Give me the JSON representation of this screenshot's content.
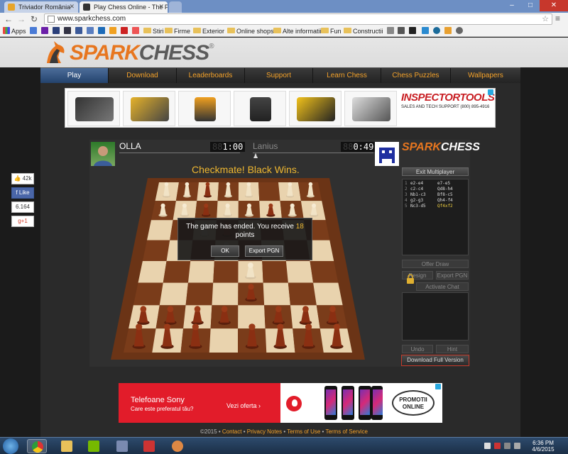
{
  "browser": {
    "tabs": [
      {
        "title": "Triviador România",
        "active": false
      },
      {
        "title": "Play Chess Online - The P",
        "active": true
      }
    ],
    "url": "www.sparkchess.com",
    "bookmarks": [
      "Apps",
      "Stiri",
      "Firme",
      "Exterior",
      "Online shops",
      "Alte informatii",
      "Fun",
      "Constructii"
    ]
  },
  "site": {
    "logo_spark": "SPARK",
    "logo_chess": "CHESS",
    "logo_reg": "®",
    "nav": [
      "Play",
      "Download",
      "Leaderboards",
      "Support",
      "Learn Chess",
      "Chess Puzzles",
      "Wallpapers"
    ],
    "active_nav": "Play"
  },
  "ad_top": {
    "brand": "INSPECTORTOOLS",
    "tagline": "SALES AND TECH SUPPORT (800) 895-4916"
  },
  "social": {
    "like_count": "42k",
    "like_label": "Like",
    "share_count": "6.164",
    "gplus_label": "+1"
  },
  "game": {
    "player_white": {
      "name": "OLLA",
      "clock": "1:00",
      "clock_ghost": "88"
    },
    "player_black": {
      "name": "Lanius",
      "clock": "0:49",
      "clock_ghost": "88"
    },
    "status": "Checkmate! Black Wins.",
    "logo_spark": "SPARK",
    "logo_chess": "CHESS",
    "dialog": {
      "message_pre": "The game has ended. You receive",
      "points": "18",
      "message_post": "points",
      "ok_label": "OK",
      "export_label": "Export PGN"
    },
    "panel": {
      "exit_label": "Exit Multiplayer",
      "offer_draw_label": "Offer Draw",
      "resign_label": "Resign",
      "export_pgn_label": "Export PGN",
      "private_chat_label": "Activate Chat",
      "undo_label": "Undo",
      "hint_label": "Hint",
      "download_label": "Download Full Version",
      "moves": [
        {
          "n": "1",
          "w": "e2-e4",
          "b": "e7-e5",
          "highlight": false
        },
        {
          "n": "2",
          "w": "c2-c4",
          "b": "Qd8-h4",
          "highlight": false
        },
        {
          "n": "3",
          "w": "Nb1-c3",
          "b": "Bf8-c5",
          "highlight": false
        },
        {
          "n": "4",
          "w": "g2-g3",
          "b": "Qh4-f4",
          "highlight": false
        },
        {
          "n": "5",
          "w": "Nc3-d5",
          "b": "Qf4xf2",
          "highlight": true
        }
      ]
    }
  },
  "ad_bottom": {
    "title": "Telefoane Sony",
    "subtitle": "Care este preferatul tău?",
    "cta": "Vezi oferta",
    "promo_line1": "PROMOTII",
    "promo_line2": "ONLINE"
  },
  "footer": {
    "copyright": "©2015 • ",
    "links": [
      "Contact",
      "Privacy Notes",
      "Terms of Use",
      "Terms of Service"
    ]
  },
  "taskbar": {
    "time": "6:36 PM",
    "date": "4/6/2015"
  },
  "colors": {
    "accent_orange": "#f4a22a",
    "status_gold": "#f0b830",
    "nav_active": "#22416b",
    "ad_red": "#e21c2a"
  }
}
